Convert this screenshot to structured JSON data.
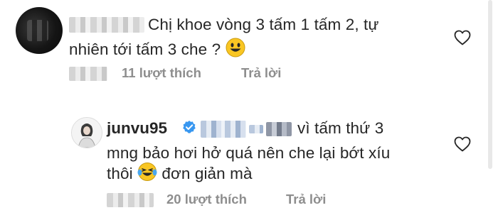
{
  "comment1": {
    "text_line1": "Chị khoe vòng 3 tấm 1 tấm 2, tự",
    "text_line2": "nhiên tới tấm 3 che ?",
    "likes": "11 lượt thích",
    "reply": "Trả lời",
    "emoji": "smiling-face-icon"
  },
  "reply1": {
    "username": "junvu95",
    "text_line1": "vì tấm thứ 3",
    "text_line2": "mng bảo hơi hở quá nên che lại bớt xíu",
    "text_line3a": "thôi",
    "text_line3b": "đơn giản mà",
    "likes": "20 lượt thích",
    "reply": "Trả lời",
    "emoji": "laughing-tears-icon"
  },
  "colors": {
    "text": "#262626",
    "meta": "#8e8e8e",
    "verified": "#3897f0",
    "emoji_yellow": "#f9c623"
  }
}
